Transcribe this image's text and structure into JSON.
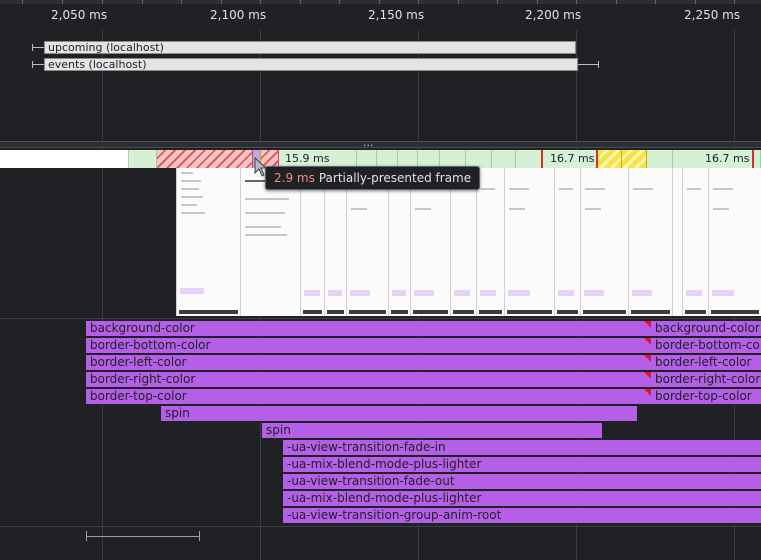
{
  "ruler": {
    "ticks": [
      "2,050 ms",
      "2,100 ms",
      "2,150 ms",
      "2,200 ms",
      "2,250 ms"
    ]
  },
  "network": {
    "requests": [
      {
        "label": "upcoming (localhost)"
      },
      {
        "label": "events (localhost)"
      }
    ]
  },
  "divider": {
    "handle": "..."
  },
  "frames": {
    "labels": [
      "15.9 ms",
      "16.7 ms",
      "16.7 ms"
    ],
    "colors": {
      "ok": "#d5f0d5",
      "dropped": "#e05a5a",
      "partial": "#f4e34c"
    }
  },
  "tooltip": {
    "duration": "2.9 ms",
    "description": "Partially-presented frame"
  },
  "animations": {
    "color": "#b55fe8",
    "rows": [
      {
        "label": "background-color",
        "label2": "background-color"
      },
      {
        "label": "border-bottom-color",
        "label2": "border-bottom-color"
      },
      {
        "label": "border-left-color",
        "label2": "border-left-color"
      },
      {
        "label": "border-right-color",
        "label2": "border-right-color"
      },
      {
        "label": "border-top-color",
        "label2": "border-top-color"
      },
      {
        "label": "spin"
      },
      {
        "label": "spin"
      },
      {
        "label": "-ua-view-transition-fade-in"
      },
      {
        "label": "-ua-mix-blend-mode-plus-lighter"
      },
      {
        "label": "-ua-view-transition-fade-out"
      },
      {
        "label": "-ua-mix-blend-mode-plus-lighter"
      },
      {
        "label": "-ua-view-transition-group-anim-root"
      }
    ]
  }
}
